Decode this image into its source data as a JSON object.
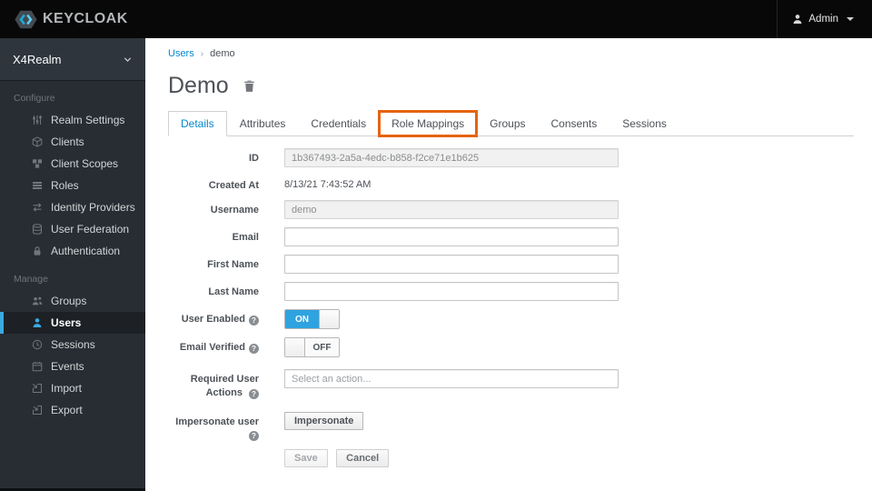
{
  "navbar": {
    "brand": "KEYCLOAK",
    "user": "Admin"
  },
  "sidebar": {
    "realm": "X4Realm",
    "sections": [
      {
        "label": "Configure",
        "items": [
          {
            "label": "Realm Settings"
          },
          {
            "label": "Clients"
          },
          {
            "label": "Client Scopes"
          },
          {
            "label": "Roles"
          },
          {
            "label": "Identity Providers"
          },
          {
            "label": "User Federation"
          },
          {
            "label": "Authentication"
          }
        ]
      },
      {
        "label": "Manage",
        "items": [
          {
            "label": "Groups"
          },
          {
            "label": "Users",
            "active": true
          },
          {
            "label": "Sessions"
          },
          {
            "label": "Events"
          },
          {
            "label": "Import"
          },
          {
            "label": "Export"
          }
        ]
      }
    ]
  },
  "breadcrumb": {
    "link": "Users",
    "separator": "›",
    "current": "demo"
  },
  "page": {
    "title": "Demo"
  },
  "tabs": {
    "items": [
      {
        "label": "Details",
        "active": true
      },
      {
        "label": "Attributes"
      },
      {
        "label": "Credentials"
      },
      {
        "label": "Role Mappings",
        "highlighted": true
      },
      {
        "label": "Groups"
      },
      {
        "label": "Consents"
      },
      {
        "label": "Sessions"
      }
    ]
  },
  "form": {
    "id": {
      "label": "ID",
      "value": "1b367493-2a5a-4edc-b858-f2ce71e1b625"
    },
    "created_at": {
      "label": "Created At",
      "value": "8/13/21 7:43:52 AM"
    },
    "username": {
      "label": "Username",
      "value": "demo"
    },
    "email": {
      "label": "Email",
      "value": ""
    },
    "first_name": {
      "label": "First Name",
      "value": ""
    },
    "last_name": {
      "label": "Last Name",
      "value": ""
    },
    "user_enabled": {
      "label": "User Enabled",
      "state": "ON"
    },
    "email_verified": {
      "label": "Email Verified",
      "state": "OFF"
    },
    "required_user_actions": {
      "label": "Required User Actions",
      "placeholder": "Select an action..."
    },
    "impersonate": {
      "label": "Impersonate user",
      "button": "Impersonate"
    },
    "actions": {
      "save": "Save",
      "cancel": "Cancel"
    }
  },
  "colors": {
    "accent_blue": "#0088ce",
    "toggle_on_blue": "#2ea3e0",
    "nav_active_blue": "#39a9e0",
    "highlight_orange": "#e5640f",
    "navbar_bg": "#080808",
    "sidebar_bg": "#282d33"
  }
}
